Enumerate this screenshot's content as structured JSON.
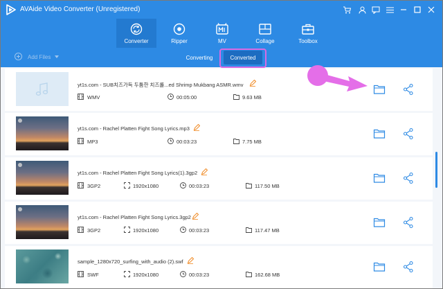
{
  "app": {
    "title": "AVAide Video Converter (Unregistered)"
  },
  "window_controls": [
    {
      "name": "cart-icon"
    },
    {
      "name": "user-icon"
    },
    {
      "name": "chat-icon"
    },
    {
      "name": "menu-icon"
    },
    {
      "name": "minimize-icon"
    },
    {
      "name": "maximize-icon"
    },
    {
      "name": "close-icon"
    }
  ],
  "nav": {
    "tabs": [
      {
        "label": "Converter",
        "icon": "converter-icon",
        "active": true
      },
      {
        "label": "Ripper",
        "icon": "ripper-icon",
        "active": false
      },
      {
        "label": "MV",
        "icon": "mv-icon",
        "active": false
      },
      {
        "label": "Collage",
        "icon": "collage-icon",
        "active": false
      },
      {
        "label": "Toolbox",
        "icon": "toolbox-icon",
        "active": false
      }
    ]
  },
  "toolbar": {
    "add_files": "Add Files",
    "converting": "Converting",
    "converted": "Converted",
    "selected": "Converted"
  },
  "files": [
    {
      "name": "yt1s.com - SUB치즈가득 두툼한 치즈롤...ed Shrimp Mukbang ASMR.wmv",
      "format": "WMV",
      "resolution": "",
      "duration": "00:05:00",
      "size": "9.63 MB",
      "thumb": "placeholder"
    },
    {
      "name": "yt1s.com - Rachel Platten  Fight Song Lyrics.mp3",
      "format": "MP3",
      "resolution": "",
      "duration": "00:03:23",
      "size": "7.75 MB",
      "thumb": "sunset"
    },
    {
      "name": "yt1s.com - Rachel Platten  Fight Song Lyrics(1).3gp2",
      "format": "3GP2",
      "resolution": "1920x1080",
      "duration": "00:03:23",
      "size": "117.50 MB",
      "thumb": "sunset"
    },
    {
      "name": "yt1s.com - Rachel Platten  Fight Song Lyrics.3gp2",
      "format": "3GP2",
      "resolution": "1920x1080",
      "duration": "00:03:23",
      "size": "117.47 MB",
      "thumb": "sunset"
    },
    {
      "name": "sample_1280x720_surfing_with_audio (2).swf",
      "format": "SWF",
      "resolution": "1920x1080",
      "duration": "00:03:23",
      "size": "162.68 MB",
      "thumb": "sea"
    }
  ],
  "colors": {
    "header": "#2d8ae4",
    "active_tab": "#237ad0",
    "highlight": "#d86ae2",
    "action_icon": "#2d8ae4",
    "edit_icon": "#f08a24"
  }
}
